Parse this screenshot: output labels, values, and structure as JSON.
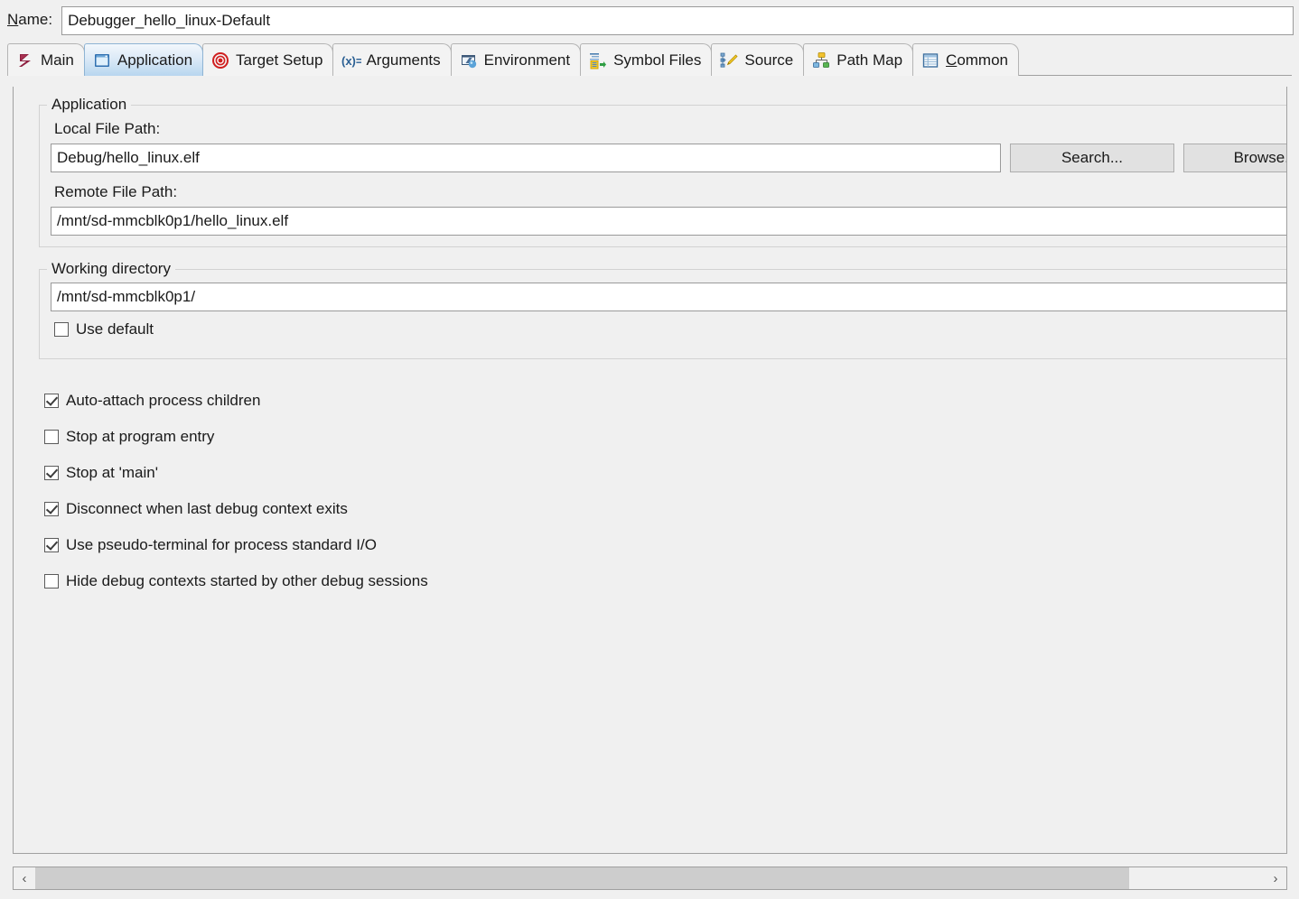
{
  "name_field": {
    "label_mnemonic": "N",
    "label_rest": "ame:",
    "value": "Debugger_hello_linux-Default"
  },
  "tabs": [
    {
      "label": "Main",
      "icon": "eclipse-x-icon",
      "selected": false
    },
    {
      "label": "Application",
      "icon": "window-icon",
      "selected": true
    },
    {
      "label": "Target Setup",
      "icon": "target-bullseye-icon",
      "selected": false
    },
    {
      "label": "Arguments",
      "icon": "variable-xequals-icon",
      "selected": false
    },
    {
      "label": "Environment",
      "icon": "environment-icon",
      "selected": false
    },
    {
      "label": "Symbol Files",
      "icon": "symbol-files-icon",
      "selected": false
    },
    {
      "label": "Source",
      "icon": "source-pencil-icon",
      "selected": false
    },
    {
      "label": "Path Map",
      "icon": "path-map-icon",
      "selected": false
    },
    {
      "label": "Common",
      "icon": "common-table-icon",
      "selected": false,
      "mnemonic": "C",
      "label_rest": "ommon"
    }
  ],
  "application_group": {
    "title": "Application",
    "local_file_path_label": "Local File Path:",
    "local_file_path_value": "Debug/hello_linux.elf",
    "search_button": "Search...",
    "browse_button": "Browse...",
    "remote_file_path_label": "Remote File Path:",
    "remote_file_path_value": "/mnt/sd-mmcblk0p1/hello_linux.elf"
  },
  "working_directory_group": {
    "title": "Working directory",
    "value": "/mnt/sd-mmcblk0p1/",
    "use_default_label": "Use default",
    "use_default_checked": false
  },
  "options": [
    {
      "label": "Auto-attach process children",
      "checked": true
    },
    {
      "label": "Stop at program entry",
      "checked": false
    },
    {
      "label": "Stop at 'main'",
      "checked": true
    },
    {
      "label": "Disconnect when last debug context exits",
      "checked": true
    },
    {
      "label": "Use pseudo-terminal for process standard I/O",
      "checked": true
    },
    {
      "label": "Hide debug contexts started by other debug sessions",
      "checked": false
    }
  ],
  "scrollbar": {
    "left_arrow": "‹",
    "right_arrow": "›"
  },
  "colors": {
    "background": "#f0f0f0",
    "selected_tab": "#b8d6ef",
    "target_red": "#d01f1f",
    "accent_blue": "#3a78b5"
  }
}
